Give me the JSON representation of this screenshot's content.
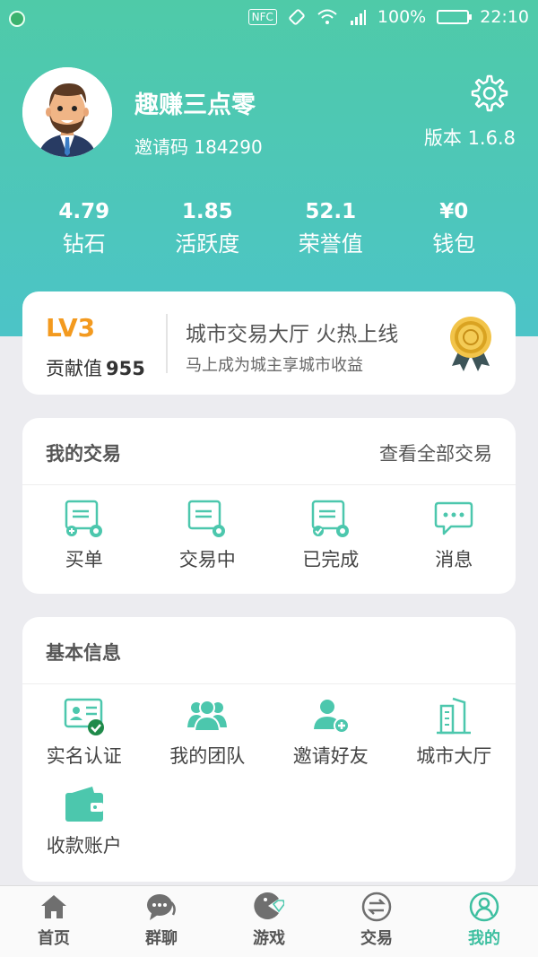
{
  "status_bar": {
    "nfc": "NFC",
    "battery": "100%",
    "time": "22:10"
  },
  "profile": {
    "name": "趣赚三点零",
    "invite_label": "邀请码",
    "invite_code": "184290",
    "version": "版本 1.6.8"
  },
  "stats": [
    {
      "value": "4.79",
      "label": "钻石"
    },
    {
      "value": "1.85",
      "label": "活跃度"
    },
    {
      "value": "52.1",
      "label": "荣誉值"
    },
    {
      "value": "¥0",
      "label": "钱包"
    }
  ],
  "level": {
    "level": "LV3",
    "contribution_label": "贡献值",
    "contribution_value": "955",
    "promo_title": "城市交易大厅 火热上线",
    "promo_subtitle": "马上成为城主享城市收益"
  },
  "trades": {
    "title": "我的交易",
    "view_all": "查看全部交易",
    "items": [
      {
        "label": "买单",
        "icon": "buy-order-icon"
      },
      {
        "label": "交易中",
        "icon": "trading-icon"
      },
      {
        "label": "已完成",
        "icon": "completed-icon"
      },
      {
        "label": "消息",
        "icon": "message-icon"
      }
    ]
  },
  "info": {
    "title": "基本信息",
    "items": [
      {
        "label": "实名认证",
        "icon": "id-verified-icon"
      },
      {
        "label": "我的团队",
        "icon": "team-icon"
      },
      {
        "label": "邀请好友",
        "icon": "add-friend-icon"
      },
      {
        "label": "城市大厅",
        "icon": "city-building-icon"
      },
      {
        "label": "收款账户",
        "icon": "wallet-icon"
      }
    ]
  },
  "tabs": [
    {
      "label": "首页",
      "icon": "home-icon"
    },
    {
      "label": "群聊",
      "icon": "chat-icon"
    },
    {
      "label": "游戏",
      "icon": "game-icon"
    },
    {
      "label": "交易",
      "icon": "exchange-icon"
    },
    {
      "label": "我的",
      "icon": "profile-icon",
      "active": true
    }
  ],
  "colors": {
    "accent": "#4cc7ad",
    "level": "#f39a1f"
  }
}
